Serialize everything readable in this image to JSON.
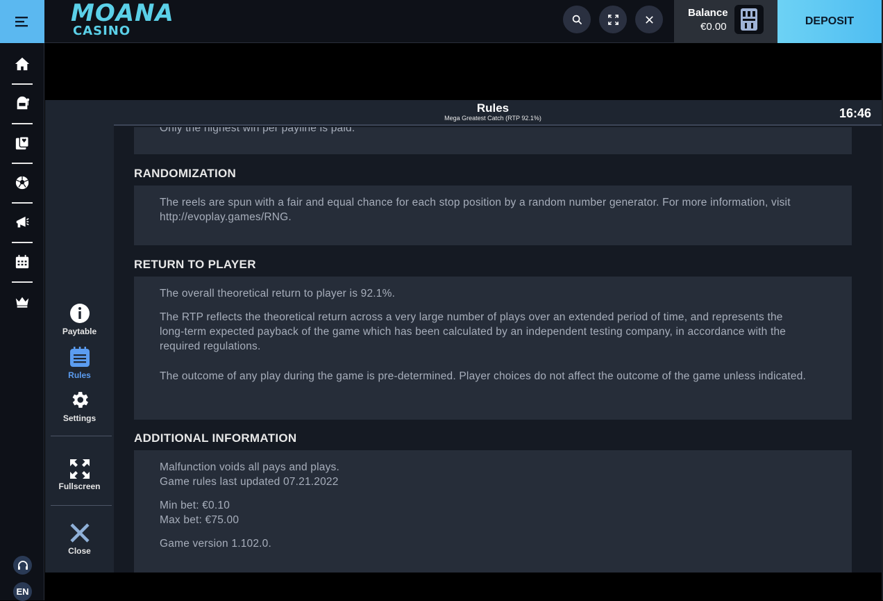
{
  "brand": {
    "logo_line1": "MOANA",
    "logo_line2": "CASINO"
  },
  "topbar": {
    "balance_label": "Balance",
    "balance_value": "€0.00",
    "deposit_label": "DEPOSIT"
  },
  "nav": [
    "home-icon",
    "slot-machine-icon",
    "cards-icon",
    "soccer-ball-icon",
    "megaphone-icon",
    "calendar-icon",
    "crown-icon"
  ],
  "footer": {
    "lang": "EN"
  },
  "game_menu": {
    "paytable": "Paytable",
    "rules": "Rules",
    "settings": "Settings",
    "fullscreen": "Fullscreen",
    "close": "Close"
  },
  "header": {
    "title": "Rules",
    "subtitle": "Mega Greatest Catch (RTP 92.1%)",
    "clock": "16:46"
  },
  "rules": {
    "cut_text": "Only the highest win per payline is paid.",
    "randomization": {
      "heading": "RANDOMIZATION",
      "text": "The reels are spun with a fair and equal chance for each stop position by a random number generator. For more information, visit http://evoplay.games/RNG."
    },
    "rtp": {
      "heading": "RETURN TO PLAYER",
      "p1": "The overall theoretical return to player is 92.1%.",
      "p2": "The RTP reflects the theoretical return across a very large number of plays over an extended period of time, and represents the long-term expected payback of the game which has been calculated by an independent testing company, in accordance with the required regulations.",
      "p3": "The outcome of any play during the game is pre-determined. Player choices do not affect the outcome of the game unless indicated."
    },
    "additional": {
      "heading": "ADDITIONAL INFORMATION",
      "l1": "Malfunction voids all pays and plays.",
      "l2": "Game rules last updated 07.21.2022",
      "l3": "Min bet: €0.10",
      "l4": "Max bet: €75.00",
      "l5": "Game version 1.102.0."
    }
  }
}
